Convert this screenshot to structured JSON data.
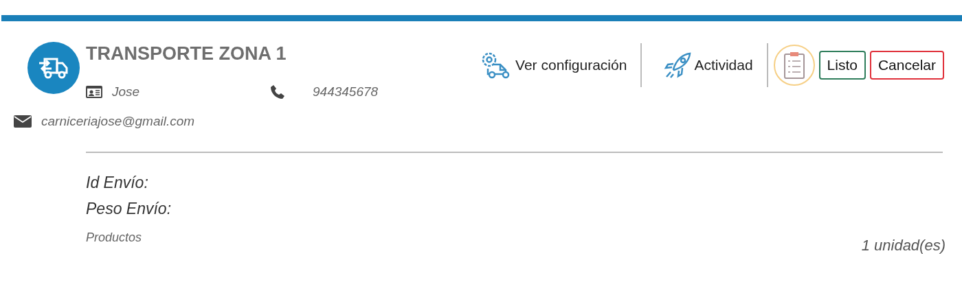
{
  "header": {
    "title": "TRANSPORTE ZONA 1",
    "contact_name": "Jose",
    "phone": "944345678",
    "email": "carniceriajose@gmail.com"
  },
  "toolbar": {
    "links": [
      {
        "kind": "config",
        "label": "Ver configuración"
      },
      {
        "kind": "activity",
        "label": "Actividad"
      }
    ],
    "buttons": [
      {
        "kind": "confirm",
        "label": "Listo"
      },
      {
        "kind": "cancel",
        "label": "Cancelar"
      }
    ]
  },
  "details": {
    "fields": [
      "Id Envío:",
      "Peso Envío:"
    ],
    "products_label": "Productos",
    "quantity": "1 unidad(es)"
  }
}
